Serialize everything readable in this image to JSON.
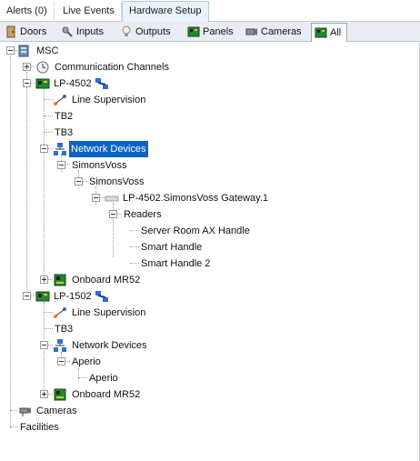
{
  "top_tabs": {
    "alerts": "Alerts (0)",
    "live_events": "Live Events",
    "hardware_setup": "Hardware Setup"
  },
  "sub_tabs": {
    "doors": "Doors",
    "inputs": "Inputs",
    "outputs": "Outputs",
    "panels": "Panels",
    "cameras": "Cameras",
    "all": "All"
  },
  "tree": {
    "msc": "MSC",
    "communication_channels": "Communication Channels",
    "lp4502": "LP-4502",
    "lp4502_line_supervision": "Line Supervision",
    "tb2": "TB2",
    "tb3_a": "TB3",
    "lp4502_network_devices": "Network Devices",
    "simonsvoss_1": "SimonsVoss",
    "simonsvoss_2": "SimonsVoss",
    "gateway": "LP-4502.SimonsVoss Gateway.1",
    "readers": "Readers",
    "reader_1": "Server Room AX Handle",
    "reader_2": "Smart Handle",
    "reader_3": "Smart Handle 2",
    "lp4502_onboard": "Onboard MR52",
    "lp1502": "LP-1502",
    "lp1502_line_supervision": "Line Supervision",
    "tb3_b": "TB3",
    "lp1502_network_devices": "Network Devices",
    "aperio_1": "Aperio",
    "aperio_2": "Aperio",
    "lp1502_onboard": "Onboard MR52",
    "cameras": "Cameras",
    "facilities": "Facilities"
  },
  "colors": {
    "selection": "#0a64c8",
    "active_tab_bg": "#eaf2fb",
    "subtab_bar_bg": "#e9edf3"
  }
}
